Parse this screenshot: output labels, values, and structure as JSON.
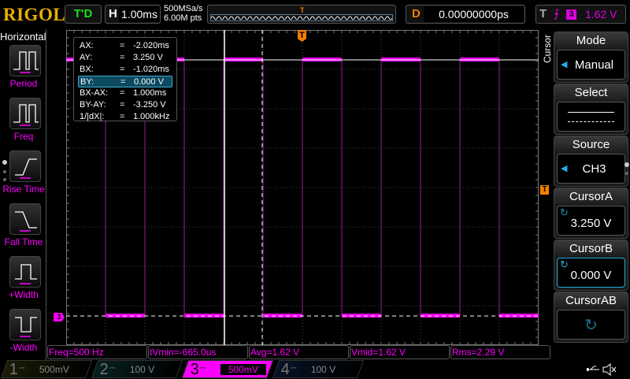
{
  "header": {
    "logo": "RIGOL",
    "run_state": "T'D",
    "h_label": "H",
    "timebase": "1.00ms",
    "sample_rate": "500MSa/s",
    "memory_depth": "6.00M pts",
    "delay_label": "D",
    "delay": "0.00000000ps",
    "trigger_label": "T",
    "trigger_channel": "3",
    "trigger_level": "1.62 V"
  },
  "left_panel": {
    "title": "Horizontal",
    "items": [
      {
        "label": "Period"
      },
      {
        "label": "Freq"
      },
      {
        "label": "Rise Time"
      },
      {
        "label": "Fall Time"
      },
      {
        "label": "+Width"
      },
      {
        "label": "-Width"
      }
    ]
  },
  "cursor_readout": [
    {
      "name": "AX:",
      "value": "-2.020ms"
    },
    {
      "name": "AY:",
      "value": "3.250 V"
    },
    {
      "name": "BX:",
      "value": "-1.020ms"
    },
    {
      "name": "BY:",
      "value": "0.000 V"
    },
    {
      "name": "BX-AX:",
      "value": "1.000ms"
    },
    {
      "name": "BY-AY:",
      "value": "-3.250 V"
    },
    {
      "name": "1/|dX|:",
      "value": "1.000kHz"
    }
  ],
  "eq": "=",
  "markers": {
    "trigger": "T",
    "ch3": "3"
  },
  "measurements": [
    "Freq=500 Hz",
    "tVmin=-665.0us",
    "Avg=1.62 V",
    "Vmid=1.62 V",
    "Rms=2.29 V"
  ],
  "channels": [
    {
      "num": "1",
      "scale": "500mV",
      "color": "#8a8a20"
    },
    {
      "num": "2",
      "scale": "100 V",
      "color": "#20a0a0"
    },
    {
      "num": "3",
      "scale": "500mV",
      "color": "#ff00ff"
    },
    {
      "num": "4",
      "scale": "100 V",
      "color": "#2060c0"
    }
  ],
  "menu": {
    "title": "Cursor",
    "mode_label": "Mode",
    "mode_value": "Manual",
    "select_label": "Select",
    "source_label": "Source",
    "source_value": "CH3",
    "cursor_a_label": "CursorA",
    "cursor_a_value": "3.250 V",
    "cursor_b_label": "CursorB",
    "cursor_b_value": "0.000 V",
    "cursor_ab_label": "CursorAB"
  },
  "colors": {
    "trace": "#ff00ff",
    "trigger": "#f08000",
    "accent": "#20b0e0",
    "logo": "#e8b000"
  }
}
